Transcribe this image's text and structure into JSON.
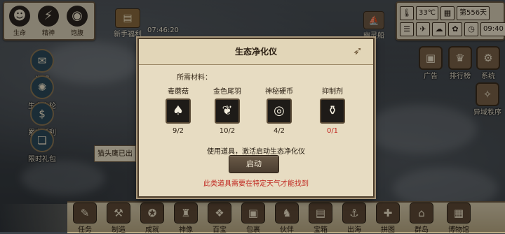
{
  "top_left_stats": [
    {
      "icon": "head-silhouette-icon",
      "glyph": "☻",
      "label": "生命"
    },
    {
      "icon": "lightning-head-icon",
      "glyph": "⚡",
      "label": "精神"
    },
    {
      "icon": "stomach-icon",
      "glyph": "◉",
      "label": "饱腹"
    }
  ],
  "top_events": {
    "welfare": {
      "label": "新手福利",
      "timer": "07:46:20"
    },
    "right_event": {
      "label": "幽灵船"
    }
  },
  "status_panel": {
    "temperature": "33℃",
    "day": "第556天",
    "time": "09:40"
  },
  "left_sidebar": [
    {
      "label": "说明"
    },
    {
      "label": "生命之轮"
    },
    {
      "label": "累充返利"
    },
    {
      "label": "限时礼包"
    }
  ],
  "right_sidebar": [
    {
      "label": "广告"
    },
    {
      "label": "排行榜"
    },
    {
      "label": "系统"
    },
    {
      "label": "异域秩序"
    }
  ],
  "toast_text": "猫头鹰已出",
  "bottom_bar": [
    {
      "label": "任务",
      "glyph": "✎"
    },
    {
      "label": "制造",
      "glyph": "⚒"
    },
    {
      "label": "成就",
      "glyph": "✪"
    },
    {
      "label": "神像",
      "glyph": "♜"
    },
    {
      "label": "百宝",
      "glyph": "❖"
    },
    {
      "label": "包裹",
      "glyph": "▣"
    },
    {
      "label": "伙伴",
      "glyph": "♞"
    },
    {
      "label": "宝箱",
      "glyph": "▤"
    },
    {
      "label": "出海",
      "glyph": "⚓"
    },
    {
      "label": "拼图",
      "glyph": "✚"
    },
    {
      "label": "群岛",
      "glyph": "⌂"
    },
    {
      "label": "博物馆",
      "glyph": "▦"
    }
  ],
  "dialog": {
    "title": "生态净化仪",
    "materials_label": "所需材料：",
    "materials": [
      {
        "name": "毒蘑菇",
        "icon": "mushroom-icon",
        "glyph": "♠",
        "count": "9/2",
        "sufficient": true
      },
      {
        "name": "金色尾羽",
        "icon": "feather-icon",
        "glyph": "❦",
        "count": "10/2",
        "sufficient": true
      },
      {
        "name": "神秘硬币",
        "icon": "coin-icon",
        "glyph": "◎",
        "count": "4/2",
        "sufficient": true
      },
      {
        "name": "抑制剂",
        "icon": "potion-flask-icon",
        "glyph": "⚱",
        "count": "0/1",
        "sufficient": false
      }
    ],
    "description": "使用道具，激活启动生态净化仪",
    "start_button": "启动",
    "warning": "此类道具需要在特定天气才能找到"
  }
}
